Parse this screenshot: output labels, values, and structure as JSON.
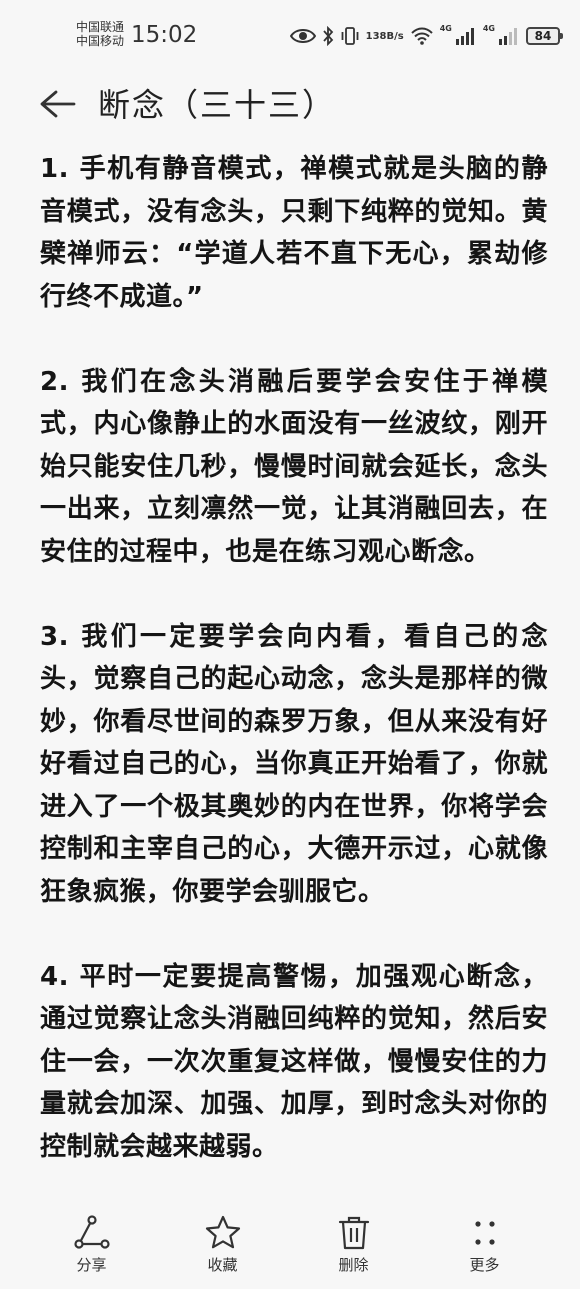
{
  "status_bar": {
    "carrier_1": "中国联通",
    "carrier_2": "中国移动",
    "time": "15:02",
    "net_speed_value": "138",
    "net_speed_unit": "B/s",
    "signal_1_label": "4G",
    "signal_2_label": "4G",
    "battery": "84"
  },
  "header": {
    "title": "断念（三十三）"
  },
  "article": {
    "paragraphs": [
      "1. 手机有静音模式，禅模式就是头脑的静音模式，没有念头，只剩下纯粹的觉知。黄檗禅师云：“学道人若不直下无心，累劫修行终不成道。”",
      "2. 我们在念头消融后要学会安住于禅模式，内心像静止的水面没有一丝波纹，刚开始只能安住几秒，慢慢时间就会延长，念头一出来，立刻凛然一觉，让其消融回去，在安住的过程中，也是在练习观心断念。",
      "3. 我们一定要学会向内看，看自己的念头，觉察自己的起心动念，念头是那样的微妙，你看尽世间的森罗万象，但从来没有好好看过自己的心，当你真正开始看了，你就进入了一个极其奥妙的内在世界，你将学会控制和主宰自己的心，大德开示过，心就像狂象疯猴，你要学会驯服它。",
      "4. 平时一定要提高警惕，加强观心断念，通过觉察让念头消融回纯粹的觉知，然后安住一会，一次次重复这样做，慢慢安住的力量就会加深、加强、加厚，到时念头对你的控制就会越来越弱。"
    ]
  },
  "toolbar": {
    "share": "分享",
    "favorite": "收藏",
    "delete": "删除",
    "more": "更多"
  },
  "icons": {
    "back": "arrow-left-icon",
    "eye": "eye-icon",
    "bluetooth": "bluetooth-icon",
    "vibrate": "vibrate-icon",
    "wifi": "wifi-icon",
    "signal": "signal-bars-icon",
    "share": "share-icon",
    "favorite": "star-icon",
    "delete": "trash-icon",
    "more": "dots-icon"
  }
}
